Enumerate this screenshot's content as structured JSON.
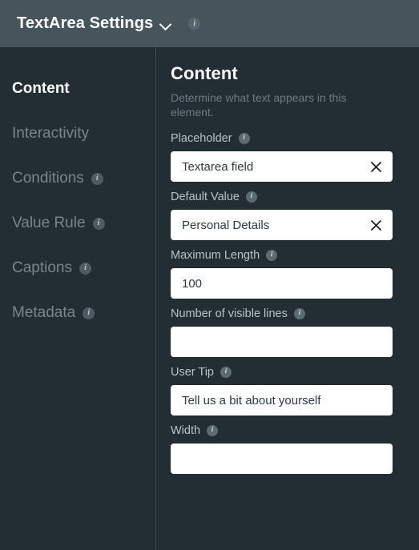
{
  "header": {
    "title": "TextArea Settings",
    "dropdown_icon": "chevron-down-icon",
    "info_icon": "info-icon",
    "background_color": "#46555c"
  },
  "sidebar": {
    "items": [
      {
        "label": "Content",
        "active": true,
        "has_info": false
      },
      {
        "label": "Interactivity",
        "active": false,
        "has_info": false
      },
      {
        "label": "Conditions",
        "active": false,
        "has_info": true
      },
      {
        "label": "Value Rule",
        "active": false,
        "has_info": true
      },
      {
        "label": "Captions",
        "active": false,
        "has_info": true
      },
      {
        "label": "Metadata",
        "active": false,
        "has_info": true
      }
    ]
  },
  "main": {
    "title": "Content",
    "description": "Determine what text appears in this element.",
    "fields": [
      {
        "label": "Placeholder",
        "value": "Textarea field",
        "has_info": true,
        "has_clear": true
      },
      {
        "label": "Default Value",
        "value": "Personal Details",
        "has_info": true,
        "has_clear": true
      },
      {
        "label": "Maximum Length",
        "value": "100",
        "has_info": true,
        "has_clear": false
      },
      {
        "label": "Number of visible lines",
        "value": "",
        "has_info": true,
        "has_clear": false
      },
      {
        "label": "User Tip",
        "value": "Tell us a bit about yourself",
        "has_info": true,
        "has_clear": false
      },
      {
        "label": "Width",
        "value": "",
        "has_info": true,
        "has_clear": false
      }
    ]
  },
  "colors": {
    "header_bg": "#46555c",
    "body_bg": "#232e34",
    "input_bg": "#ffffff",
    "label_text": "#b6c1c8",
    "muted_text": "#77848d"
  }
}
